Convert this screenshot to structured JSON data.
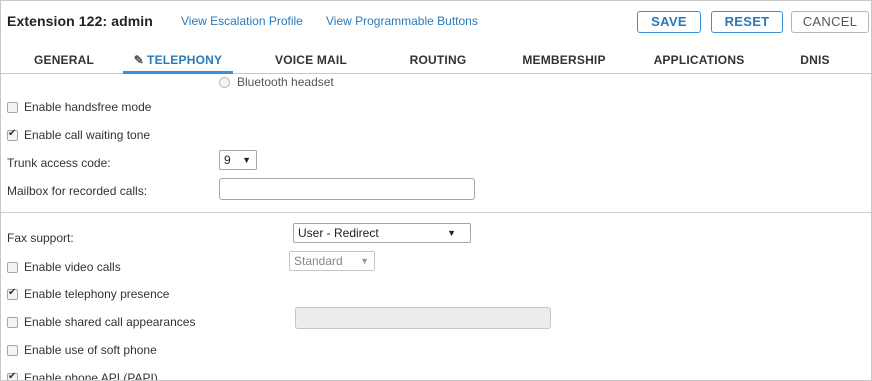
{
  "header": {
    "title": "Extension 122: admin",
    "links": [
      "View Escalation Profile",
      "View Programmable Buttons"
    ],
    "save_label": "SAVE",
    "reset_label": "RESET",
    "cancel_label": "CANCEL"
  },
  "tabs": [
    {
      "label": "GENERAL",
      "active": false
    },
    {
      "label": "TELEPHONY",
      "active": true
    },
    {
      "label": "VOICE MAIL",
      "active": false
    },
    {
      "label": "ROUTING",
      "active": false
    },
    {
      "label": "MEMBERSHIP",
      "active": false
    },
    {
      "label": "APPLICATIONS",
      "active": false
    },
    {
      "label": "DNIS",
      "active": false
    }
  ],
  "settings": {
    "partial_option_label": "Bluetooth headset",
    "handsfree": {
      "label": "Enable handsfree mode",
      "checked": false
    },
    "call_waiting": {
      "label": "Enable call waiting tone",
      "checked": true
    },
    "trunk_access": {
      "label": "Trunk access code:",
      "value": "9"
    },
    "mailbox_recorded": {
      "label": "Mailbox for recorded calls:",
      "value": ""
    },
    "fax_support": {
      "label": "Fax support:",
      "value": "User - Redirect"
    },
    "video_calls": {
      "label": "Enable video calls",
      "checked": false,
      "value": "Standard"
    },
    "telephony_presence": {
      "label": "Enable telephony presence",
      "checked": true
    },
    "shared_call": {
      "label": "Enable shared call appearances",
      "checked": false,
      "value": ""
    },
    "soft_phone": {
      "label": "Enable use of soft phone",
      "checked": false
    },
    "phone_api": {
      "label": "Enable phone API (PAPI)",
      "checked": true
    }
  },
  "icons": {
    "tab_icon": "pencil-icon",
    "dropdown_icon": "triangle-down-icon"
  },
  "colors": {
    "accent": "#3b8fd6",
    "link": "#2a7ab8"
  }
}
